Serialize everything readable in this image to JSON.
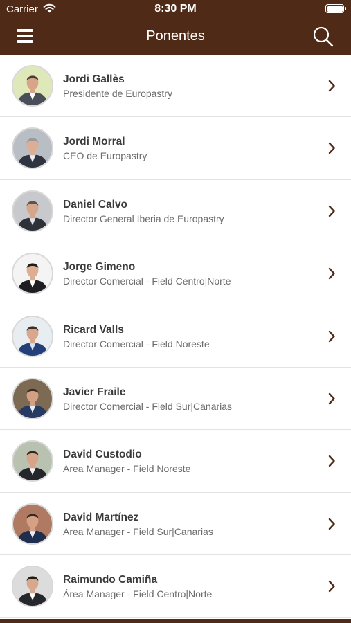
{
  "status_bar": {
    "carrier": "Carrier",
    "time": "8:30 PM"
  },
  "header": {
    "title": "Ponentes",
    "menu_icon": "hamburger-menu-icon",
    "search_icon": "search-icon"
  },
  "colors": {
    "brand": "#4e2a17",
    "name_text": "#3b3b3b",
    "role_text": "#6b6b6b",
    "divider": "#e3e3e3"
  },
  "speakers": [
    {
      "name": "Jordi Gallès",
      "role": "Presidente de Europastry",
      "bg": "#dfe8b8",
      "suit": "#4a4e58",
      "shirt": "#ffffff",
      "skin": "#d8a58a",
      "hair": "#4a3a30"
    },
    {
      "name": "Jordi Morral",
      "role": "CEO de Europastry",
      "bg": "#b9bec4",
      "suit": "#2f3440",
      "shirt": "#e9eef4",
      "skin": "#dcae94",
      "hair": "#9a9a9a"
    },
    {
      "name": "Daniel Calvo",
      "role": "Director General Iberia de Europastry",
      "bg": "#c7c9cc",
      "suit": "#2e3138",
      "shirt": "#dfe4ea",
      "skin": "#d6a68c",
      "hair": "#5a5550"
    },
    {
      "name": "Jorge Gimeno",
      "role": "Director Comercial - Field Centro|Norte",
      "bg": "#f4f4f4",
      "suit": "#1e1e22",
      "shirt": "#ffffff",
      "skin": "#deae93",
      "hair": "#1d1a18"
    },
    {
      "name": "Ricard Valls",
      "role": "Director Comercial - Field Noreste",
      "bg": "#e8edf2",
      "suit": "#23407a",
      "shirt": "#d7e3f2",
      "skin": "#d8a78c",
      "hair": "#3b2f28"
    },
    {
      "name": "Javier Fraile",
      "role": "Director Comercial - Field Sur|Canarias",
      "bg": "#7c6a53",
      "suit": "#273a63",
      "shirt": "#e7edf5",
      "skin": "#d3a083",
      "hair": "#3a2c22"
    },
    {
      "name": "David Custodio",
      "role": "Área Manager - Field Noreste",
      "bg": "#b9c2b0",
      "suit": "#24262c",
      "shirt": "#f2f2f2",
      "skin": "#d6a488",
      "hair": "#2e2622"
    },
    {
      "name": "David Martínez",
      "role": "Área Manager - Field Sur|Canarias",
      "bg": "#b07a62",
      "suit": "#1f2d4f",
      "shirt": "#e6ecf5",
      "skin": "#d5a084",
      "hair": "#342820"
    },
    {
      "name": "Raimundo Camiña",
      "role": "Área Manager - Field Centro|Norte",
      "bg": "#dcdcdc",
      "suit": "#26282e",
      "shirt": "#ffffff",
      "skin": "#d8a88c",
      "hair": "#1f1c1a"
    }
  ]
}
